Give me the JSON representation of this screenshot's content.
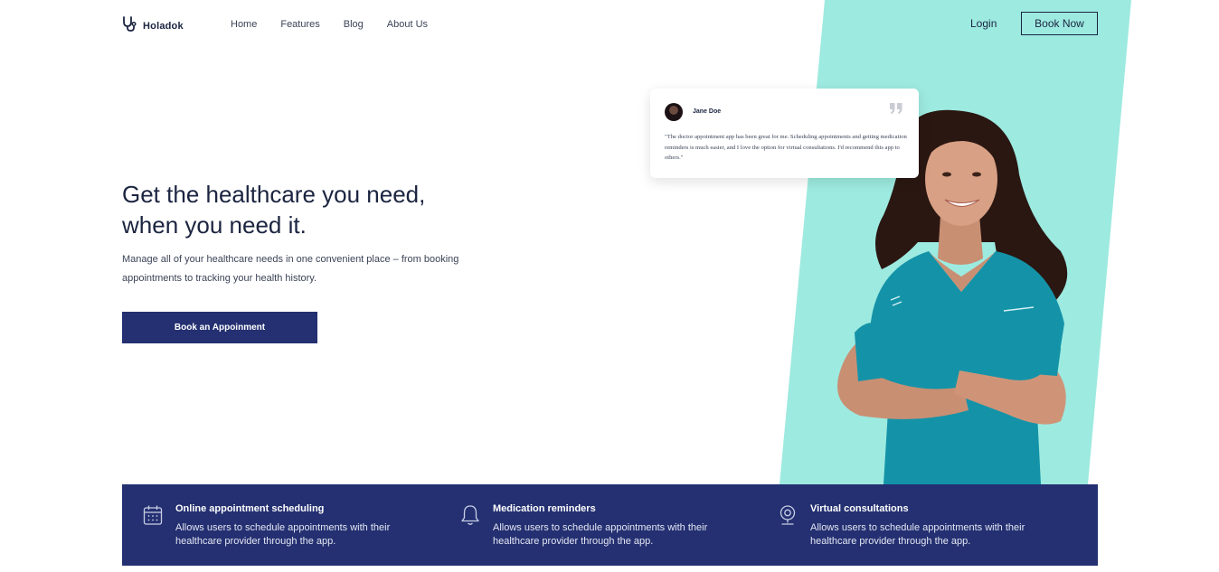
{
  "brand": {
    "name": "Holadok",
    "logo_icon": "stethoscope-icon"
  },
  "nav": {
    "items": [
      {
        "label": "Home"
      },
      {
        "label": "Features"
      },
      {
        "label": "Blog"
      },
      {
        "label": "About Us"
      }
    ]
  },
  "header": {
    "login_label": "Login",
    "book_now_label": "Book Now"
  },
  "hero": {
    "title_line1": "Get the healthcare you need,",
    "title_line2": "when you need it.",
    "subtitle": "Manage all of your healthcare needs in one convenient place – from booking appointments to tracking your health history.",
    "cta_label": "Book an Appoinment"
  },
  "testimonial": {
    "name": "Jane Doe",
    "text": "\"The doctor appointment app has been great for me. Scheduling appointments and getting medication reminders is much easier, and I love the option for virtual consultations. I'd recommend this app to others.\"",
    "quote_icon": "quote-icon"
  },
  "features": [
    {
      "icon": "calendar-icon",
      "title": "Online appointment scheduling",
      "description": "Allows users to schedule appointments with their healthcare provider through the app."
    },
    {
      "icon": "bell-icon",
      "title": "Medication reminders",
      "description": "Allows users to schedule appointments with their healthcare provider through the app."
    },
    {
      "icon": "webcam-icon",
      "title": "Virtual consultations",
      "description": "Allows users to schedule appointments with their healthcare provider through the app."
    }
  ],
  "colors": {
    "accent_teal": "#9deae0",
    "primary_navy": "#243071",
    "text_dark": "#1b2440",
    "scrubs_teal": "#1493a8"
  }
}
